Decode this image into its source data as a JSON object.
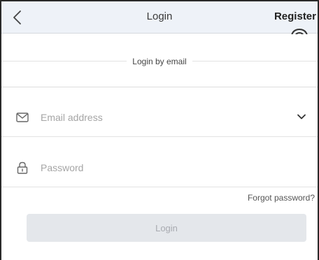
{
  "header": {
    "title": "Login",
    "register_label": "Register",
    "back_icon": "chevron-left-icon",
    "pointer_icon": "hand-pointer-icon"
  },
  "subheader": {
    "label": "Login by email"
  },
  "email_field": {
    "placeholder": "Email address",
    "value": "",
    "icon": "envelope-icon",
    "dropdown_icon": "chevron-down-icon"
  },
  "password_field": {
    "placeholder": "Password",
    "value": "",
    "icon": "lock-icon"
  },
  "forgot_password_label": "Forgot password?",
  "login_button_label": "Login",
  "colors": {
    "header_bg": "#eef2f8",
    "button_bg": "#e4e7eb",
    "button_text": "#a8aab0",
    "placeholder": "#a5a5a5"
  }
}
